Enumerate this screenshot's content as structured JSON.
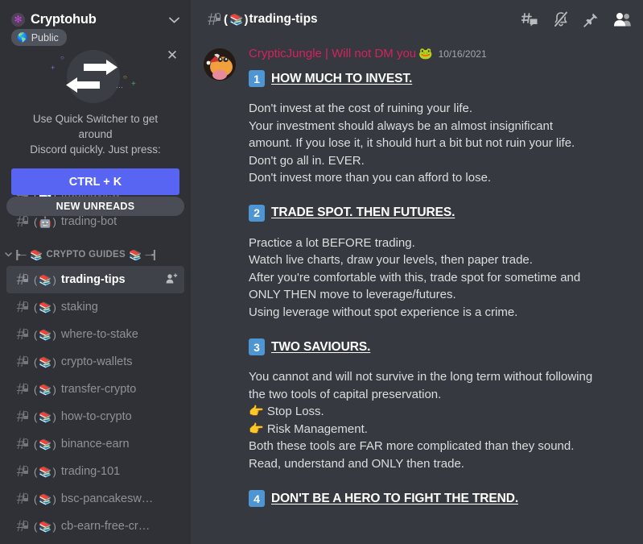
{
  "sidebar": {
    "server": {
      "name": "Cryptohub",
      "icon": "gear-icon",
      "chevron": "⌄"
    },
    "public_badge": {
      "label": "Public",
      "icon": "globe-icon"
    },
    "quick_switcher": {
      "close": "✕",
      "text_line1": "Use Quick Switcher to get around",
      "text_line2": "Discord quickly. Just press:",
      "button_label": "CTRL + K",
      "button_color": "#5865f2"
    },
    "unread_pill": {
      "label": "NEW UNREADS"
    },
    "channels_top": [
      {
        "name": "tradingview",
        "emoji": "📉",
        "locked": true,
        "dim": true
      },
      {
        "name": "trading-bot",
        "emoji": "🤖",
        "locked": true,
        "dim": false
      }
    ],
    "category": {
      "label": "CRYPTO GUIDES",
      "emoji": "📚",
      "chevron": "⌄"
    },
    "channels": [
      {
        "name": "trading-tips",
        "emoji": "📚",
        "locked": true,
        "active": true,
        "invite_icon": "add-member-icon"
      },
      {
        "name": "staking",
        "emoji": "📚",
        "locked": true,
        "active": false
      },
      {
        "name": "where-to-stake",
        "emoji": "📚",
        "locked": true,
        "active": false
      },
      {
        "name": "crypto-wallets",
        "emoji": "📚",
        "locked": true,
        "active": false
      },
      {
        "name": "transfer-crypto",
        "emoji": "📚",
        "locked": true,
        "active": false
      },
      {
        "name": "how-to-crypto",
        "emoji": "📚",
        "locked": true,
        "active": false
      },
      {
        "name": "binance-earn",
        "emoji": "📚",
        "locked": true,
        "active": false
      },
      {
        "name": "trading-101",
        "emoji": "📚",
        "locked": true,
        "active": false
      },
      {
        "name": "bsc-pancakesw…",
        "emoji": "📚",
        "locked": true,
        "active": false
      },
      {
        "name": "cb-earn-free-cr…",
        "emoji": "📚",
        "locked": true,
        "active": false
      }
    ]
  },
  "header": {
    "channel_name": "trading-tips",
    "channel_emoji": "📚",
    "bracket_open": "(",
    "bracket_close": ")",
    "icons": [
      "threads-icon",
      "notifications-muted-icon",
      "pin-icon",
      "members-icon"
    ]
  },
  "message": {
    "author": "CrypticJungle | Will not DM you",
    "author_color": "#d6225c",
    "author_emoji": "🐸",
    "timestamp": "10/16/2021",
    "sections": [
      {
        "number": "1",
        "title": "HOW MUCH TO INVEST.",
        "lines": [
          "Don't invest at the cost of ruining your life.",
          "Your investment should always be an almost insignificant",
          "amount. If you lose it, it should hurt a bit but not ruin your life.",
          "Don't go all in. EVER.",
          "Don't invest more than you can afford to lose."
        ]
      },
      {
        "number": "2",
        "title": "TRADE SPOT. THEN FUTURES.",
        "lines": [
          "Practice a lot BEFORE trading.",
          "Watch live charts, draw your levels, then paper trade.",
          "After you're comfortable with this, trade spot for sometime and",
          "ONLY THEN move to leverage/futures.",
          "Using leverage without spot experience is a crime."
        ]
      },
      {
        "number": "3",
        "title": "TWO SAVIOURS.",
        "lines": [
          "You cannot and will not survive in the long term without following",
          "the two tools of capital preservation.",
          "👉 Stop Loss.",
          "👉 Risk Management.",
          "Both these tools are FAR more complicated than they sound.",
          "Read, understand and ONLY then trade."
        ]
      },
      {
        "number": "4",
        "title": "DON'T BE A HERO TO FIGHT THE TREND.",
        "lines": []
      }
    ]
  },
  "colors": {
    "sidebar_bg": "#2f3136",
    "main_bg": "#36393f",
    "accent_blurple": "#5865f2",
    "badge_blue": "#4e96d3",
    "active_channel_bg": "#3f4248"
  }
}
